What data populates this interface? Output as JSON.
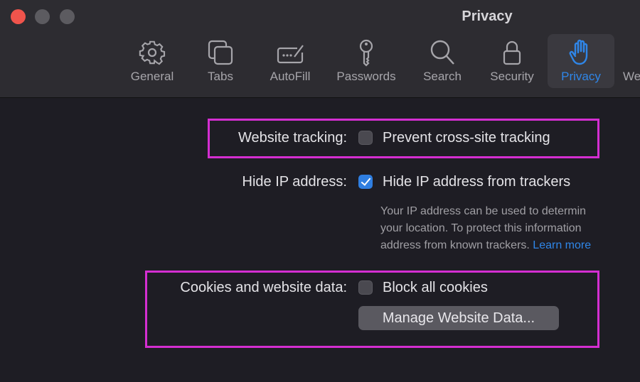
{
  "window": {
    "title": "Privacy",
    "controls": [
      "close",
      "minimize",
      "maximize"
    ]
  },
  "toolbar": {
    "items": [
      {
        "label": "General",
        "icon": "gear-icon",
        "active": false
      },
      {
        "label": "Tabs",
        "icon": "tabs-icon",
        "active": false
      },
      {
        "label": "AutoFill",
        "icon": "autofill-icon",
        "active": false
      },
      {
        "label": "Passwords",
        "icon": "key-icon",
        "active": false
      },
      {
        "label": "Search",
        "icon": "search-icon",
        "active": false
      },
      {
        "label": "Security",
        "icon": "lock-icon",
        "active": false
      },
      {
        "label": "Privacy",
        "icon": "hand-icon",
        "active": true
      },
      {
        "label": "We",
        "icon": "websites-icon",
        "active": false
      }
    ]
  },
  "settings": {
    "website_tracking": {
      "label": "Website tracking:",
      "checkbox_label": "Prevent cross-site tracking",
      "checked": false
    },
    "hide_ip": {
      "label": "Hide IP address:",
      "checkbox_label": "Hide IP address from trackers",
      "checked": true,
      "description_lines": [
        "Your IP address can be used to determin",
        "your location. To protect this information",
        "address from known trackers. "
      ],
      "learn_more": "Learn more"
    },
    "cookies": {
      "label": "Cookies and website data:",
      "checkbox_label": "Block all cookies",
      "checked": false,
      "manage_button": "Manage Website Data..."
    }
  },
  "colors": {
    "accent": "#2f86e8",
    "highlight": "#d42ed1",
    "background": "#1e1d24",
    "toolbar": "#2d2c31"
  }
}
